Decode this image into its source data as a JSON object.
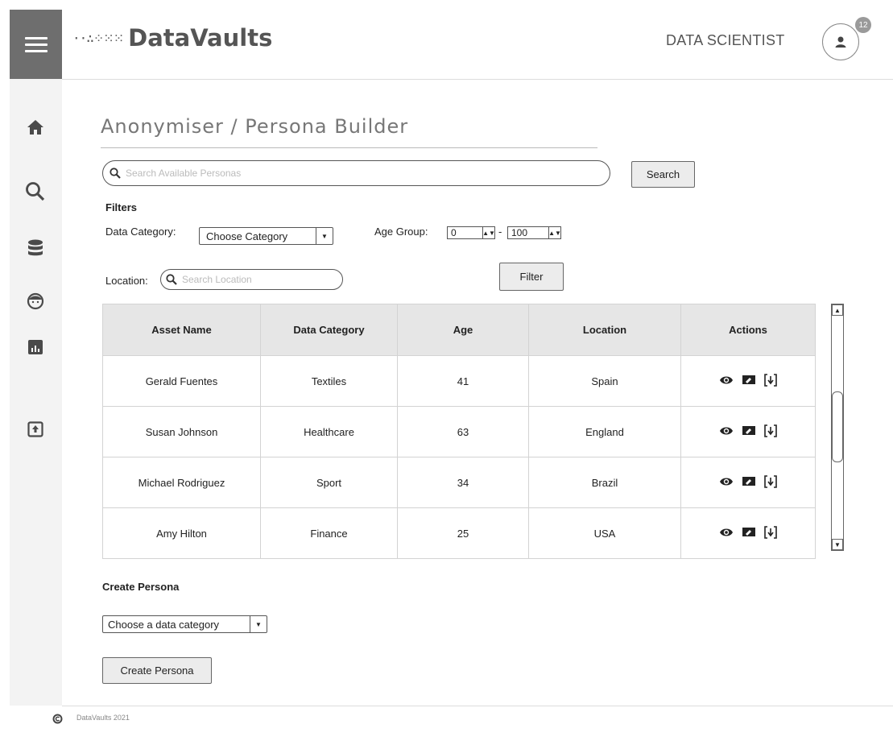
{
  "header": {
    "logo_text": "DataVaults",
    "role": "DATA SCIENTIST",
    "notification_count": "12"
  },
  "sidebar": {
    "items": [
      {
        "icon": "home-icon"
      },
      {
        "icon": "search-icon"
      },
      {
        "icon": "database-icon"
      },
      {
        "icon": "persona-face-icon"
      },
      {
        "icon": "bar-chart-icon"
      },
      {
        "icon": "upload-icon"
      }
    ]
  },
  "page": {
    "title": "Anonymiser / Persona Builder"
  },
  "search": {
    "placeholder": "Search Available Personas",
    "button_label": "Search"
  },
  "filters": {
    "heading": "Filters",
    "data_category_label": "Data Category:",
    "data_category_value": "Choose Category",
    "age_group_label": "Age Group:",
    "age_min": "0",
    "age_separator": "-",
    "age_max": "100",
    "location_label": "Location:",
    "location_placeholder": "Search Location",
    "filter_button": "Filter"
  },
  "table": {
    "columns": [
      "Asset Name",
      "Data Category",
      "Age",
      "Location",
      "Actions"
    ],
    "rows": [
      {
        "name": "Gerald Fuentes",
        "category": "Textiles",
        "age": "41",
        "location": "Spain"
      },
      {
        "name": "Susan Johnson",
        "category": "Healthcare",
        "age": "63",
        "location": "England"
      },
      {
        "name": "Michael Rodriguez",
        "category": "Sport",
        "age": "34",
        "location": "Brazil"
      },
      {
        "name": "Amy Hilton",
        "category": "Finance",
        "age": "25",
        "location": "USA"
      }
    ]
  },
  "create": {
    "heading": "Create Persona",
    "select_value": "Choose a data category",
    "button_label": "Create Persona"
  },
  "footer": {
    "text": "DataVaults 2021"
  }
}
